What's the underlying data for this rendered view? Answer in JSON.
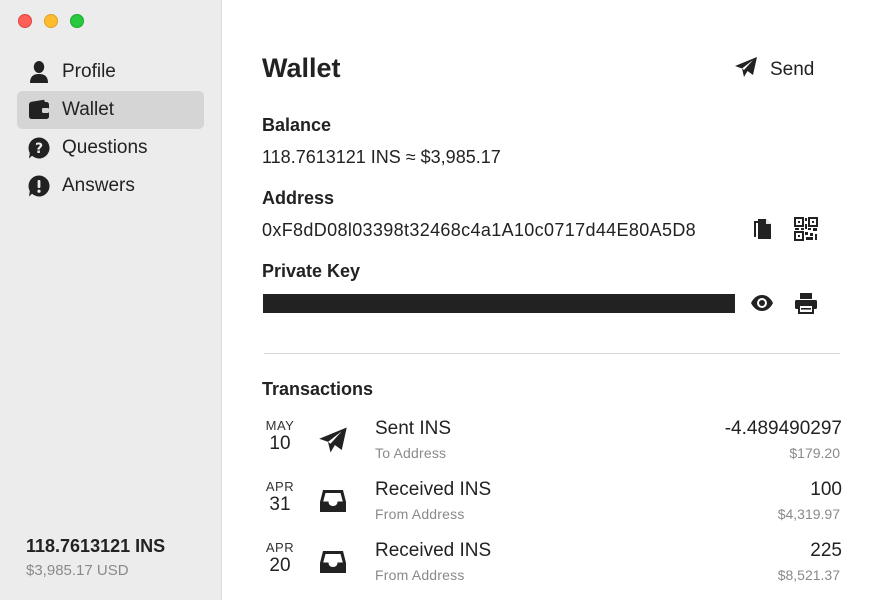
{
  "sidebar": {
    "items": [
      {
        "label": "Profile",
        "icon": "person-icon",
        "active": false
      },
      {
        "label": "Wallet",
        "icon": "wallet-icon",
        "active": true
      },
      {
        "label": "Questions",
        "icon": "question-icon",
        "active": false
      },
      {
        "label": "Answers",
        "icon": "exclamation-icon",
        "active": false
      }
    ],
    "balance_ins": "118.7613121 INS",
    "balance_usd": "$3,985.17 USD"
  },
  "main": {
    "title": "Wallet",
    "send_label": "Send",
    "balance": {
      "label": "Balance",
      "value": "118.7613121 INS ≈ $3,985.17"
    },
    "address": {
      "label": "Address",
      "value": "0xF8dD08l03398t32468c4a1A10c0717d44E80A5D8"
    },
    "private_key": {
      "label": "Private Key"
    },
    "transactions": {
      "label": "Transactions",
      "items": [
        {
          "month": "MAY",
          "day": "10",
          "name": "Sent INS",
          "sub": "To Address",
          "amount": "-4.489490297",
          "usd": "$179.20",
          "icon": "send-icon"
        },
        {
          "month": "APR",
          "day": "31",
          "name": "Received INS",
          "sub": "From Address",
          "amount": "100",
          "usd": "$4,319.97",
          "icon": "inbox-icon"
        },
        {
          "month": "APR",
          "day": "20",
          "name": "Received INS",
          "sub": "From Address",
          "amount": "225",
          "usd": "$8,521.37",
          "icon": "inbox-icon"
        }
      ]
    }
  },
  "colors": {
    "sidebar_bg": "#ececec",
    "active_item": "#d5d5d5",
    "muted_text": "#8a8a8a",
    "traffic_red": "#fe5f57",
    "traffic_yellow": "#febc2e",
    "traffic_green": "#28c840"
  }
}
